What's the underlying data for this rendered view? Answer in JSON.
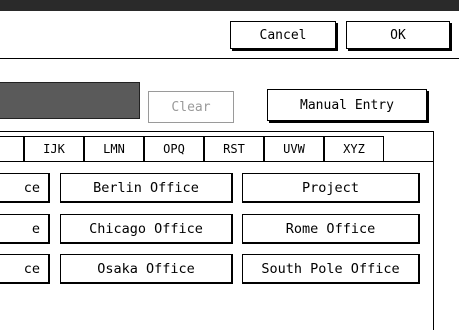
{
  "header": {
    "cancel_label": "Cancel",
    "ok_label": "OK"
  },
  "toolbar": {
    "clear_label": "Clear",
    "manual_entry_label": "Manual Entry"
  },
  "tabs": [
    {
      "label": "IJK"
    },
    {
      "label": "LMN"
    },
    {
      "label": "OPQ"
    },
    {
      "label": "RST"
    },
    {
      "label": "UVW"
    },
    {
      "label": "XYZ"
    }
  ],
  "destinations": [
    {
      "left": "ce",
      "middle": "Berlin Office",
      "right": "Project"
    },
    {
      "left": "e",
      "middle": "Chicago Office",
      "right": "Rome Office"
    },
    {
      "left": "ce",
      "middle": "Osaka Office",
      "right": "South Pole Office"
    }
  ]
}
